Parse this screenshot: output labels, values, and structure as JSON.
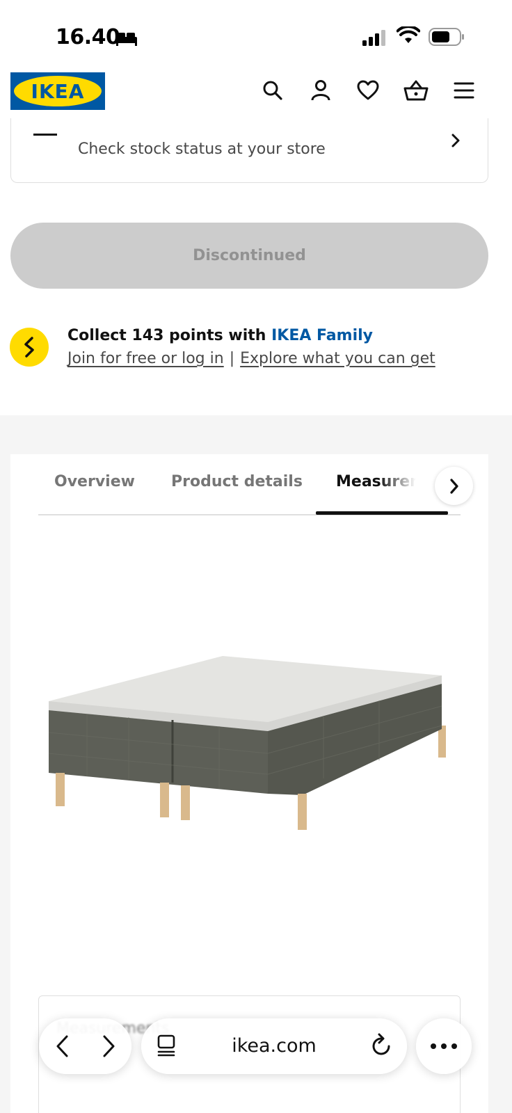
{
  "status_bar": {
    "time": "16.40",
    "icons": [
      "bed-icon",
      "signal-icon",
      "wifi-icon",
      "battery-icon"
    ]
  },
  "header": {
    "logo_text": "IKEA",
    "icons": [
      "search-icon",
      "profile-icon",
      "heart-icon",
      "basket-icon",
      "menu-icon"
    ]
  },
  "stock": {
    "label": "Check stock status at your store"
  },
  "purchase": {
    "button_label": "Discontinued"
  },
  "family": {
    "title_prefix": "Collect 143 points with ",
    "title_link": "IKEA Family",
    "join_link": "Join for free or log in",
    "separator": "|",
    "explore_link": "Explore what you can get"
  },
  "tabs": {
    "items": [
      {
        "label": "Overview"
      },
      {
        "label": "Product details"
      },
      {
        "label": "Measurements"
      }
    ],
    "active_index": 2
  },
  "lower_card": {
    "partial_text": "Measurements"
  },
  "browser": {
    "url": "ikea.com",
    "icons": [
      "back-icon",
      "forward-icon",
      "tabs-icon",
      "reload-icon",
      "more-icon"
    ]
  },
  "colors": {
    "ikea_blue": "#0058a3",
    "ikea_yellow": "#ffdb00",
    "disabled_button": "#cccccc",
    "page_grey": "#f5f5f5"
  }
}
